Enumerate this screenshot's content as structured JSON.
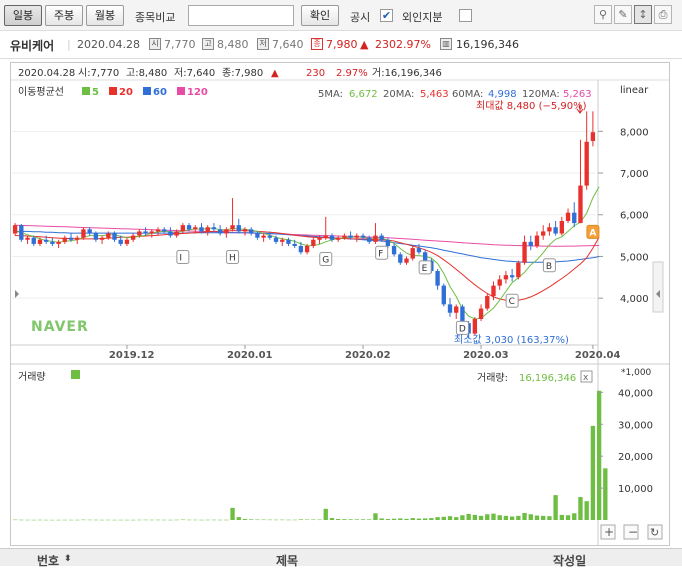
{
  "toolbar": {
    "daily": "일봉",
    "weekly": "주봉",
    "monthly": "월봉",
    "compare": "종목비교",
    "confirm": "확인",
    "disclosure": "공시",
    "disclosure_checked": "✔",
    "foreign": "외인지분",
    "icons": [
      "pin-icon",
      "edit-icon",
      "cursor-icon",
      "print-icon"
    ]
  },
  "info": {
    "name": "유비케어",
    "date": "2020.04.28",
    "open_tag": "시",
    "open": "7,770",
    "high_tag": "고",
    "high": "8,480",
    "low_tag": "저",
    "low": "7,640",
    "close_tag": "종",
    "close": "7,980",
    "change_arrow": "▲",
    "change": "230",
    "pct": "2.97%",
    "volume": "16,196,346"
  },
  "chart_header": {
    "date": "2020.04.28",
    "open": "시:7,770",
    "high": "고:8,480",
    "low": "저:7,640",
    "close": "종:7,980",
    "arrow": "▲",
    "change": "230",
    "pct": "2.97%",
    "vol": "거:16,196,346"
  },
  "ma_legend": {
    "title": "이동평균선",
    "items": [
      {
        "label": "5",
        "color": "#6fbe44"
      },
      {
        "label": "20",
        "color": "#e8302d"
      },
      {
        "label": "60",
        "color": "#2f6fd6"
      },
      {
        "label": "120",
        "color": "#e84ca5"
      }
    ],
    "values_label5": "5MA:",
    "value5": "6,672",
    "values_label20": "20MA:",
    "value20": "5,463",
    "values_label60": "60MA:",
    "value60": "4,998",
    "values_label120": "120MA:",
    "value120": "5,263",
    "scale": "linear"
  },
  "annotations": {
    "max": "최대값 8,480 (−5,90%)",
    "min": "최소값 3,030 (163,37%)",
    "events": [
      "I",
      "H",
      "G",
      "F",
      "E",
      "D",
      "C",
      "B",
      "A"
    ]
  },
  "watermark": "NAVER",
  "volume_panel": {
    "title": "거래량",
    "value_label": "거래량:",
    "value": "16,196,346",
    "unit": "*1,000",
    "close": "x"
  },
  "table_header": {
    "num": "번호",
    "sort": "⬍",
    "title": "제목",
    "author": "작성일"
  },
  "chart_data": {
    "type": "candlestick",
    "ylim": [
      2900,
      8800
    ],
    "yticks": [
      "4,000",
      "5,000",
      "6,000",
      "7,000",
      "8,000"
    ],
    "xticks": [
      "2019.12",
      "2020.01",
      "2020.02",
      "2020.03",
      "2020.04"
    ],
    "last_close": 7980,
    "candles": [
      [
        5550,
        5800,
        5500,
        5750
      ],
      [
        5750,
        5780,
        5350,
        5400
      ],
      [
        5400,
        5500,
        5300,
        5450
      ],
      [
        5450,
        5500,
        5250,
        5300
      ],
      [
        5300,
        5450,
        5250,
        5400
      ],
      [
        5400,
        5500,
        5300,
        5350
      ],
      [
        5350,
        5450,
        5250,
        5300
      ],
      [
        5300,
        5400,
        5200,
        5350
      ],
      [
        5350,
        5500,
        5300,
        5450
      ],
      [
        5450,
        5550,
        5350,
        5400
      ],
      [
        5400,
        5500,
        5300,
        5450
      ],
      [
        5450,
        5700,
        5400,
        5650
      ],
      [
        5650,
        5700,
        5500,
        5550
      ],
      [
        5550,
        5600,
        5350,
        5400
      ],
      [
        5400,
        5500,
        5300,
        5450
      ],
      [
        5450,
        5600,
        5400,
        5550
      ],
      [
        5550,
        5600,
        5350,
        5400
      ],
      [
        5400,
        5500,
        5250,
        5300
      ],
      [
        5300,
        5450,
        5250,
        5400
      ],
      [
        5400,
        5550,
        5350,
        5500
      ],
      [
        5500,
        5650,
        5450,
        5600
      ],
      [
        5600,
        5700,
        5500,
        5550
      ],
      [
        5550,
        5650,
        5450,
        5600
      ],
      [
        5600,
        5700,
        5500,
        5650
      ],
      [
        5650,
        5700,
        5550,
        5600
      ],
      [
        5600,
        5700,
        5450,
        5500
      ],
      [
        5500,
        5650,
        5450,
        5600
      ],
      [
        5600,
        5800,
        5550,
        5750
      ],
      [
        5750,
        5800,
        5600,
        5650
      ],
      [
        5650,
        5750,
        5550,
        5700
      ],
      [
        5700,
        5800,
        5550,
        5600
      ],
      [
        5600,
        5750,
        5500,
        5700
      ],
      [
        5700,
        5800,
        5600,
        5650
      ],
      [
        5650,
        5750,
        5500,
        5550
      ],
      [
        5550,
        5700,
        5450,
        5650
      ],
      [
        5650,
        6400,
        5600,
        5750
      ],
      [
        5750,
        5900,
        5550,
        5600
      ],
      [
        5600,
        5700,
        5500,
        5650
      ],
      [
        5650,
        5700,
        5500,
        5550
      ],
      [
        5550,
        5600,
        5400,
        5450
      ],
      [
        5450,
        5550,
        5350,
        5500
      ],
      [
        5500,
        5600,
        5400,
        5450
      ],
      [
        5450,
        5500,
        5300,
        5350
      ],
      [
        5350,
        5450,
        5250,
        5400
      ],
      [
        5400,
        5450,
        5250,
        5300
      ],
      [
        5300,
        5400,
        5200,
        5250
      ],
      [
        5250,
        5350,
        5050,
        5100
      ],
      [
        5100,
        5300,
        5050,
        5250
      ],
      [
        5250,
        5450,
        5200,
        5400
      ],
      [
        5400,
        5500,
        5300,
        5450
      ],
      [
        5450,
        5950,
        5400,
        5500
      ],
      [
        5500,
        5550,
        5350,
        5400
      ],
      [
        5400,
        5500,
        5350,
        5450
      ],
      [
        5450,
        5550,
        5400,
        5500
      ],
      [
        5500,
        5600,
        5400,
        5450
      ],
      [
        5450,
        5550,
        5350,
        5500
      ],
      [
        5500,
        5550,
        5400,
        5450
      ],
      [
        5450,
        5500,
        5300,
        5350
      ],
      [
        5350,
        5800,
        5300,
        5500
      ],
      [
        5500,
        5550,
        5350,
        5400
      ],
      [
        5400,
        5450,
        5200,
        5250
      ],
      [
        5250,
        5300,
        5000,
        5050
      ],
      [
        5050,
        5100,
        4800,
        4850
      ],
      [
        4850,
        5000,
        4800,
        4950
      ],
      [
        4950,
        5250,
        4900,
        5200
      ],
      [
        5200,
        5300,
        5050,
        5100
      ],
      [
        5100,
        5150,
        4850,
        4900
      ],
      [
        4900,
        4950,
        4600,
        4650
      ],
      [
        4650,
        4700,
        4200,
        4300
      ],
      [
        4300,
        4350,
        3800,
        3850
      ],
      [
        3850,
        4000,
        3550,
        3650
      ],
      [
        3650,
        3850,
        3500,
        3800
      ],
      [
        3800,
        3850,
        3350,
        3400
      ],
      [
        3400,
        3450,
        3030,
        3150
      ],
      [
        3150,
        3550,
        3100,
        3500
      ],
      [
        3500,
        3850,
        3450,
        3750
      ],
      [
        3750,
        4100,
        3700,
        4050
      ],
      [
        4050,
        4400,
        3950,
        4300
      ],
      [
        4300,
        4550,
        4200,
        4450
      ],
      [
        4450,
        4650,
        4350,
        4550
      ],
      [
        4550,
        4700,
        4400,
        4500
      ],
      [
        4500,
        4900,
        4450,
        4850
      ],
      [
        4850,
        5500,
        4800,
        5350
      ],
      [
        5350,
        5500,
        5150,
        5250
      ],
      [
        5250,
        5600,
        5200,
        5500
      ],
      [
        5500,
        5750,
        5400,
        5600
      ],
      [
        5600,
        5800,
        5500,
        5700
      ],
      [
        5700,
        5850,
        5500,
        5550
      ],
      [
        5550,
        5950,
        5500,
        5850
      ],
      [
        5850,
        6150,
        5800,
        6050
      ],
      [
        6050,
        6300,
        5700,
        5800
      ],
      [
        5800,
        7800,
        5800,
        6700
      ],
      [
        6700,
        8480,
        6600,
        7750
      ],
      [
        7770,
        8480,
        7640,
        7980
      ]
    ],
    "ma5": [
      5600,
      5580,
      5520,
      5480,
      5420,
      5380,
      5360,
      5340,
      5360,
      5380,
      5400,
      5460,
      5500,
      5500,
      5500,
      5520,
      5520,
      5480,
      5450,
      5460,
      5480,
      5510,
      5560,
      5590,
      5600,
      5590,
      5580,
      5610,
      5640,
      5660,
      5650,
      5670,
      5680,
      5640,
      5640,
      5670,
      5660,
      5650,
      5630,
      5600,
      5550,
      5510,
      5460,
      5420,
      5400,
      5360,
      5300,
      5260,
      5260,
      5290,
      5350,
      5400,
      5430,
      5450,
      5460,
      5470,
      5460,
      5430,
      5440,
      5440,
      5390,
      5310,
      5190,
      5080,
      5020,
      5020,
      5000,
      4960,
      4830,
      4590,
      4280,
      4040,
      3740,
      3570,
      3500,
      3520,
      3640,
      3760,
      3950,
      4160,
      4370,
      4490,
      4620,
      4800,
      4920,
      5090,
      5280,
      5410,
      5470,
      5600,
      5740,
      5820,
      6040,
      6410,
      6672
    ],
    "ma20": [
      5500,
      5500,
      5490,
      5480,
      5470,
      5460,
      5450,
      5440,
      5430,
      5430,
      5420,
      5420,
      5420,
      5420,
      5430,
      5440,
      5450,
      5460,
      5460,
      5470,
      5480,
      5490,
      5500,
      5510,
      5520,
      5530,
      5540,
      5550,
      5560,
      5570,
      5580,
      5590,
      5600,
      5600,
      5610,
      5620,
      5620,
      5620,
      5610,
      5600,
      5590,
      5580,
      5570,
      5550,
      5530,
      5510,
      5490,
      5470,
      5460,
      5450,
      5450,
      5440,
      5430,
      5430,
      5420,
      5420,
      5420,
      5410,
      5400,
      5400,
      5390,
      5370,
      5330,
      5290,
      5250,
      5210,
      5160,
      5100,
      5020,
      4920,
      4810,
      4690,
      4570,
      4440,
      4320,
      4210,
      4110,
      4030,
      3980,
      3950,
      3940,
      3950,
      3980,
      4030,
      4100,
      4180,
      4270,
      4370,
      4470,
      4580,
      4700,
      4820,
      4970,
      5200,
      5463
    ],
    "ma60": [
      5600,
      5600,
      5600,
      5590,
      5590,
      5580,
      5580,
      5570,
      5570,
      5560,
      5560,
      5560,
      5560,
      5560,
      5560,
      5560,
      5560,
      5560,
      5560,
      5560,
      5560,
      5560,
      5560,
      5560,
      5560,
      5560,
      5560,
      5560,
      5570,
      5570,
      5570,
      5570,
      5570,
      5570,
      5570,
      5570,
      5570,
      5570,
      5570,
      5560,
      5560,
      5550,
      5540,
      5530,
      5520,
      5510,
      5500,
      5490,
      5480,
      5470,
      5460,
      5450,
      5440,
      5430,
      5420,
      5410,
      5400,
      5390,
      5380,
      5370,
      5350,
      5330,
      5310,
      5290,
      5270,
      5250,
      5230,
      5210,
      5180,
      5150,
      5120,
      5090,
      5060,
      5030,
      5000,
      4970,
      4950,
      4930,
      4910,
      4890,
      4880,
      4870,
      4860,
      4860,
      4860,
      4860,
      4860,
      4870,
      4880,
      4890,
      4910,
      4930,
      4950,
      4970,
      4998
    ],
    "ma120": [
      5750,
      5745,
      5740,
      5735,
      5730,
      5725,
      5720,
      5715,
      5710,
      5705,
      5700,
      5695,
      5690,
      5685,
      5680,
      5675,
      5670,
      5665,
      5660,
      5655,
      5650,
      5645,
      5640,
      5635,
      5630,
      5625,
      5620,
      5615,
      5610,
      5605,
      5600,
      5595,
      5590,
      5585,
      5580,
      5575,
      5570,
      5565,
      5560,
      5555,
      5550,
      5545,
      5540,
      5535,
      5530,
      5525,
      5520,
      5515,
      5510,
      5505,
      5500,
      5495,
      5490,
      5485,
      5480,
      5475,
      5470,
      5465,
      5460,
      5455,
      5450,
      5440,
      5430,
      5420,
      5410,
      5400,
      5390,
      5380,
      5370,
      5360,
      5350,
      5340,
      5330,
      5320,
      5310,
      5300,
      5290,
      5280,
      5275,
      5270,
      5265,
      5260,
      5255,
      5252,
      5250,
      5248,
      5247,
      5246,
      5246,
      5247,
      5249,
      5252,
      5255,
      5259,
      5263
    ],
    "volume": [
      120,
      80,
      70,
      60,
      75,
      65,
      55,
      60,
      70,
      65,
      70,
      120,
      90,
      80,
      70,
      75,
      65,
      70,
      60,
      65,
      80,
      90,
      85,
      90,
      75,
      70,
      85,
      140,
      95,
      80,
      70,
      85,
      90,
      75,
      80,
      3800,
      900,
      300,
      200,
      150,
      140,
      120,
      100,
      110,
      95,
      90,
      200,
      150,
      160,
      140,
      3500,
      600,
      300,
      250,
      220,
      200,
      210,
      190,
      2100,
      500,
      300,
      400,
      500,
      350,
      600,
      450,
      500,
      600,
      900,
      1000,
      1200,
      900,
      1500,
      1900,
      1600,
      1300,
      1800,
      2000,
      1500,
      1300,
      1100,
      1300,
      2200,
      1800,
      1400,
      1300,
      1200,
      7800,
      1600,
      1500,
      2100,
      7200,
      5900,
      29500,
      40500,
      16196
    ],
    "volume_ylim": [
      0,
      42000
    ],
    "volume_yticks": [
      "10,000",
      "20,000",
      "30,000",
      "40,000"
    ]
  }
}
